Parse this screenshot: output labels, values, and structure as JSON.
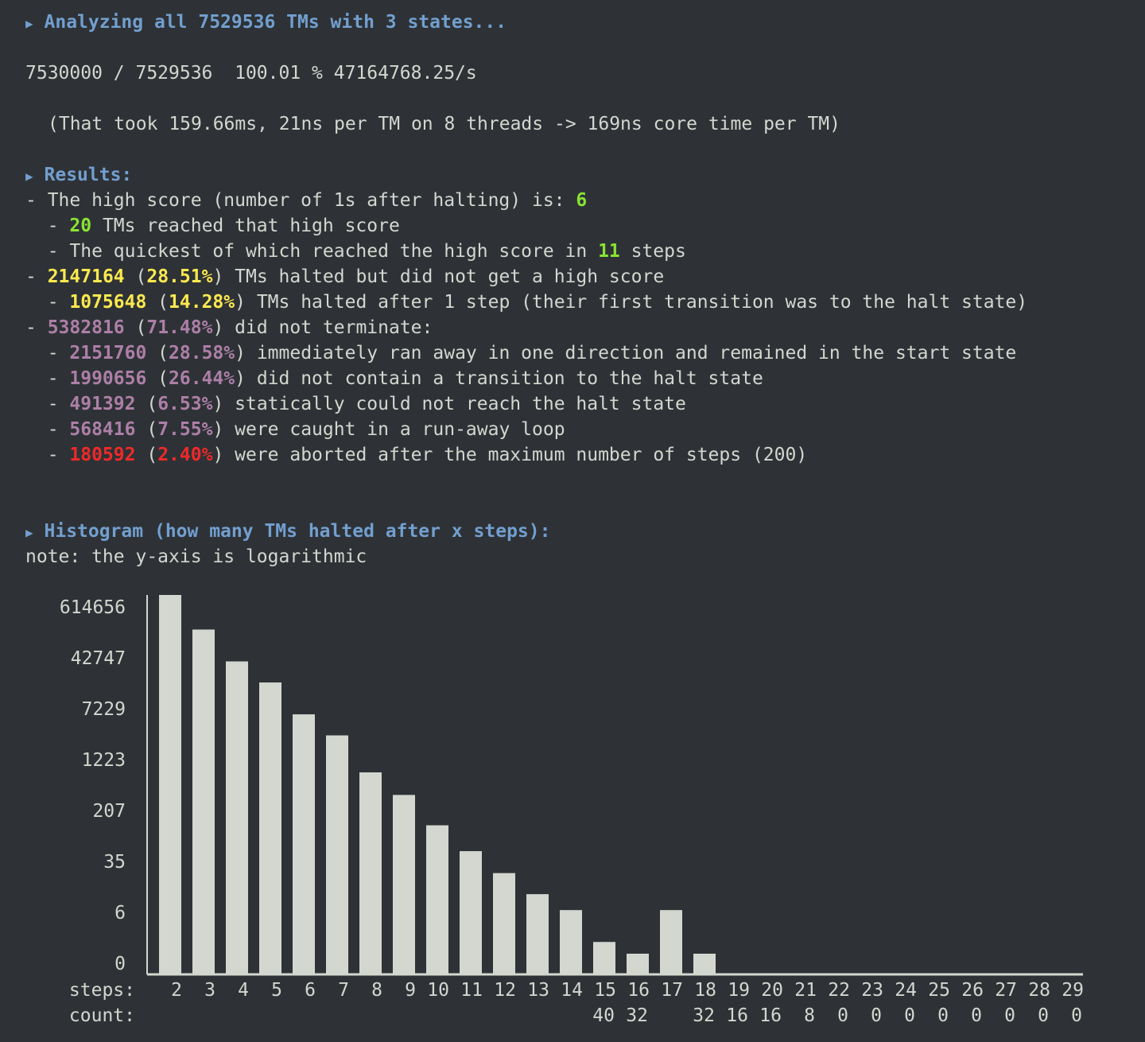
{
  "analyzing": {
    "marker": "▶",
    "text": "Analyzing all 7529536 TMs with 3 states..."
  },
  "progress": "7530000 / 7529536  100.01 % 47164768.25/s",
  "timing": "(That took 159.66ms, 21ns per TM on 8 threads -> 169ns core time per TM)",
  "results": {
    "marker": "▶",
    "title": "Results:",
    "high_score": {
      "prefix": "- The high score (number of 1s after halting) is: ",
      "value": "6"
    },
    "reached": {
      "prefix": "  - ",
      "value": "20",
      "suffix": " TMs reached that high score"
    },
    "quickest": {
      "prefix": "  - The quickest of which reached the high score in ",
      "value": "11",
      "suffix": " steps"
    },
    "halted": {
      "prefix": "- ",
      "count": "2147164",
      "open": " (",
      "pct": "28.51%",
      "suffix": ") TMs halted but did not get a high score"
    },
    "halted_one": {
      "prefix": "  - ",
      "count": "1075648",
      "open": " (",
      "pct": "14.28%",
      "suffix": ") TMs halted after 1 step (their first transition was to the halt state)"
    },
    "nonterm": {
      "prefix": "- ",
      "count": "5382816",
      "open": " (",
      "pct": "71.48%",
      "suffix": ") did not terminate:"
    },
    "runaway": {
      "prefix": "  - ",
      "count": "2151760",
      "open": " (",
      "pct": "28.58%",
      "suffix": ") immediately ran away in one direction and remained in the start state"
    },
    "no_halt": {
      "prefix": "  - ",
      "count": "1990656",
      "open": " (",
      "pct": "26.44%",
      "suffix": ") did not contain a transition to the halt state"
    },
    "static": {
      "prefix": "  - ",
      "count": "491392",
      "open": " (",
      "pct": "6.53%",
      "suffix": ") statically could not reach the halt state"
    },
    "loop": {
      "prefix": "  - ",
      "count": "568416",
      "open": " (",
      "pct": "7.55%",
      "suffix": ") were caught in a run-away loop"
    },
    "aborted": {
      "prefix": "  - ",
      "count": "180592",
      "open": " (",
      "pct": "2.40%",
      "suffix": ") were aborted after the maximum number of steps (200)"
    }
  },
  "histogram": {
    "marker": "▶",
    "title": "Histogram (how many TMs halted after x steps):",
    "note": "note: the y-axis is logarithmic"
  },
  "chart_data": {
    "type": "bar",
    "log_scale": true,
    "y_ticks": [
      "614656",
      "42747",
      "7229",
      "1223",
      "207",
      "35",
      "6",
      "0"
    ],
    "x_row_label": "steps:",
    "count_row_label": "count:",
    "categories": [
      "2",
      "3",
      "4",
      "5",
      "6",
      "7",
      "8",
      "9",
      "10",
      "11",
      "12",
      "13",
      "14",
      "15",
      "16",
      "17",
      "18",
      "19",
      "20",
      "21",
      "22",
      "23",
      "24",
      "25",
      "26",
      "27",
      "28",
      "29"
    ],
    "values": [
      900000,
      200000,
      50000,
      20000,
      5000,
      2000,
      400,
      150,
      40,
      13,
      5,
      2,
      1,
      0.25,
      0.15,
      1,
      0.15,
      0.05,
      0.05,
      0.02,
      0,
      0,
      0,
      0,
      0,
      0,
      0,
      0
    ],
    "count_labels": [
      "",
      "",
      "",
      "",
      "",
      "",
      "",
      "",
      "",
      "",
      "",
      "",
      "",
      "40",
      "32",
      "",
      "32",
      "16",
      "16",
      "8",
      "0",
      "0",
      "0",
      "0",
      "0",
      "0",
      "0",
      "0"
    ]
  }
}
